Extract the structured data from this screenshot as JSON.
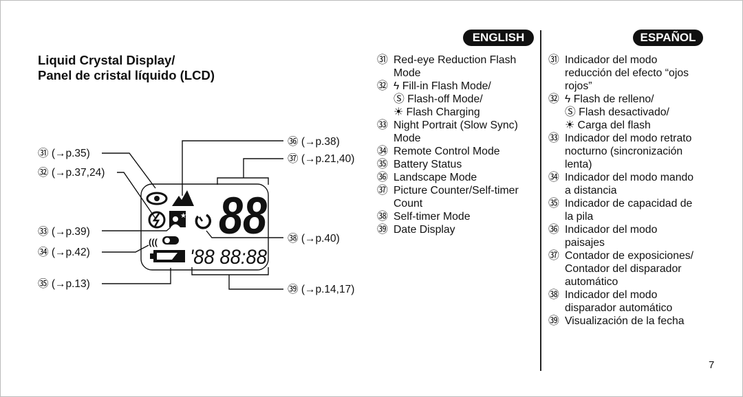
{
  "title": {
    "line1": "Liquid Crystal Display/",
    "line2": "Panel de cristal líquido (LCD)"
  },
  "badges": {
    "english": "ENGLISH",
    "spanish": "ESPAÑOL"
  },
  "diagram": {
    "callouts": [
      {
        "num": "㉛",
        "ref": "(→p.35)"
      },
      {
        "num": "㉜",
        "ref": "(→p.37,24)"
      },
      {
        "num": "㉝",
        "ref": "(→p.39)"
      },
      {
        "num": "㉞",
        "ref": "(→p.42)"
      },
      {
        "num": "㉟",
        "ref": "(→p.13)"
      },
      {
        "num": "㊱",
        "ref": "(→p.38)"
      },
      {
        "num": "㊲",
        "ref": "(→p.21,40)"
      },
      {
        "num": "㊳",
        "ref": "(→p.40)"
      },
      {
        "num": "㊴",
        "ref": "(→p.14,17)"
      }
    ],
    "counter_digits": "88",
    "date_digits": "'88 88:88"
  },
  "english": [
    {
      "num": "㉛",
      "lines": [
        "Red-eye Reduction Flash",
        "Mode"
      ]
    },
    {
      "num": "㉜",
      "lines": [
        "ϟ Fill-in Flash Mode/",
        "Ⓢ Flash-off Mode/",
        "☀ Flash Charging"
      ]
    },
    {
      "num": "㉝",
      "lines": [
        "Night Portrait (Slow Sync)",
        "Mode"
      ]
    },
    {
      "num": "㉞",
      "lines": [
        "Remote Control Mode"
      ]
    },
    {
      "num": "㉟",
      "lines": [
        "Battery Status"
      ]
    },
    {
      "num": "㊱",
      "lines": [
        "Landscape Mode"
      ]
    },
    {
      "num": "㊲",
      "lines": [
        "Picture Counter/Self-timer",
        "Count"
      ]
    },
    {
      "num": "㊳",
      "lines": [
        "Self-timer Mode"
      ]
    },
    {
      "num": "㊴",
      "lines": [
        "Date Display"
      ]
    }
  ],
  "spanish": [
    {
      "num": "㉛",
      "lines": [
        "Indicador del modo",
        "reducción del efecto “ojos",
        "rojos”"
      ]
    },
    {
      "num": "㉜",
      "lines": [
        "ϟ Flash de relleno/",
        "Ⓢ Flash desactivado/",
        "☀ Carga del flash"
      ]
    },
    {
      "num": "㉝",
      "lines": [
        "Indicador del modo retrato",
        "nocturno (sincronización",
        "lenta)"
      ]
    },
    {
      "num": "㉞",
      "lines": [
        "Indicador del modo mando",
        "a distancia"
      ]
    },
    {
      "num": "㉟",
      "lines": [
        "Indicador de capacidad de",
        "la pila"
      ]
    },
    {
      "num": "㊱",
      "lines": [
        "Indicador del modo",
        "paisajes"
      ]
    },
    {
      "num": "㊲",
      "lines": [
        "Contador de exposiciones/",
        "Contador del disparador",
        "automático"
      ]
    },
    {
      "num": "㊳",
      "lines": [
        "Indicador del modo",
        "disparador automático"
      ]
    },
    {
      "num": "㊴",
      "lines": [
        "Visualización de la fecha"
      ]
    }
  ],
  "page_number": "7"
}
